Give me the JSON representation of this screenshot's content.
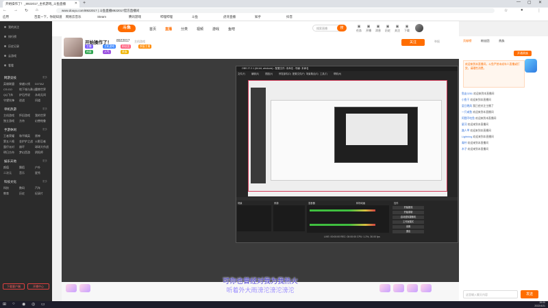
{
  "browser": {
    "tab_title": "开始操作了！_8922017_主机游戏_斗鱼直播",
    "new_tab": "+",
    "window_controls": [
      "—",
      "▢",
      "✕"
    ],
    "url": "www.douyu.com/8922017 | 斗鱼直播8922017官方直播间",
    "bookmarks": [
      "应用",
      "百度一下，你就知道",
      "网易云音乐",
      "Steam",
      "腾讯游戏",
      "哔哩哔哩",
      "斗鱼",
      "虎牙直播",
      "知乎",
      "抖音"
    ]
  },
  "sidebar": {
    "top_items": [
      "我的关注",
      "排行榜",
      "历史记录",
      "云游戏",
      "看看"
    ],
    "sections": [
      {
        "title": "网游竞技",
        "more": "更多",
        "items": [
          "英雄联盟",
          "穿越火线",
          "DOTA2",
          "CS:GO",
          "地下城与勇士",
          "魔兽世界",
          "QQ飞车",
          "炉石传说",
          "永劫无间",
          "守望先锋",
          "逆战",
          "问道"
        ]
      },
      {
        "title": "单机热游",
        "more": "更多",
        "items": [
          "主机游戏",
          "怀旧游戏",
          "我的世界",
          "独立游戏",
          "方舟",
          "幻兽帕鲁"
        ]
      },
      {
        "title": "手游休闲",
        "more": "更多",
        "items": [
          "王者荣耀",
          "和平精英",
          "原神",
          "第五人格",
          "金铲铲之战",
          "火影忍者",
          "蛋仔派对",
          "崩坏",
          "球球大作战",
          "明日方舟",
          "梦幻西游",
          "阴阳师"
        ]
      },
      {
        "title": "娱乐天地",
        "more": "更多",
        "items": [
          "颜值",
          "舞蹈",
          "户外",
          "二次元",
          "音乐",
          "星秀"
        ]
      },
      {
        "title": "科技文化",
        "more": "更多",
        "items": [
          "科技",
          "数码",
          "汽车",
          "教育",
          "历史",
          "纪录片"
        ]
      }
    ],
    "bottom_buttons": [
      "下载客户端",
      "开播中心"
    ]
  },
  "site": {
    "logo": "斗鱼",
    "nav": [
      "首页",
      "直播",
      "分类",
      "视频",
      "游戏",
      "鱼吧"
    ],
    "search_placeholder": "搜索直播",
    "search_button": "搜",
    "header_icons": [
      "任务",
      "开播",
      "消息",
      "历史",
      "关注",
      "下载"
    ]
  },
  "room": {
    "title": "开始操作了！",
    "room_id": "8922017",
    "category": "主机游戏",
    "badges": [
      "主播",
      "主机游戏",
      "粉丝团",
      "颜值主播",
      "热度",
      "人气",
      "贵族"
    ],
    "follow_button": "关注",
    "report": "举报"
  },
  "video": {
    "obs_title": "OBS 27.2.1 (64-bit, windows) - 配置文件: 未命名 - 场景: 未命名",
    "obs_menus": [
      "文件(F)",
      "编辑(E)",
      "视图(V)",
      "停靠部件(D)",
      "配置文件(P)",
      "场景集合(S)",
      "工具(T)",
      "帮助(H)"
    ],
    "obs_docks": [
      "场景",
      "来源",
      "混音器",
      "转场动画",
      "控件"
    ],
    "obs_controls": [
      "开始推流",
      "开始录制",
      "启动虚拟摄像机",
      "工作室模式",
      "设置",
      "退出"
    ],
    "obs_status": "LIVE: 00:00:00  REC: 00:00:00  CPU: 1.2%, 30.00 fps",
    "subtitle_1": "可你也曾经对我为我热火",
    "subtitle_2": "听着外大雨滂沱滂沱滂沱"
  },
  "right_panel": {
    "tabs": [
      "贡献榜",
      "粉丝团",
      "贵族"
    ],
    "vip_button": "开通贵族",
    "notice": "欢迎来到本直播间，斗鱼严禁未成年人直播或打赏，请理性消费。",
    "chat": [
      {
        "user": "鱼友0251",
        "text": "欢迎来到本直播间"
      },
      {
        "user": "小鱼干",
        "text": "欢迎来到本直播间"
      },
      {
        "user": "夏日晚风",
        "text": "我已经关注主播了"
      },
      {
        "user": "一只咸鱼",
        "text": "欢迎来到本直播间"
      },
      {
        "user": "阿狸不吃鱼",
        "text": "欢迎来到本直播间"
      },
      {
        "user": "星河",
        "text": "欢迎来到本直播间"
      },
      {
        "user": "路人甲",
        "text": "欢迎来到本直播间"
      },
      {
        "user": "Lightning",
        "text": "欢迎来到本直播间"
      },
      {
        "user": "青柠",
        "text": "欢迎来到本直播间"
      },
      {
        "user": "木子",
        "text": "欢迎来到本直播间"
      }
    ],
    "input_placeholder": "这里输入聊天内容",
    "send_button": "发送"
  },
  "taskbar": {
    "time": "15:00",
    "date": "2022/4/21"
  }
}
